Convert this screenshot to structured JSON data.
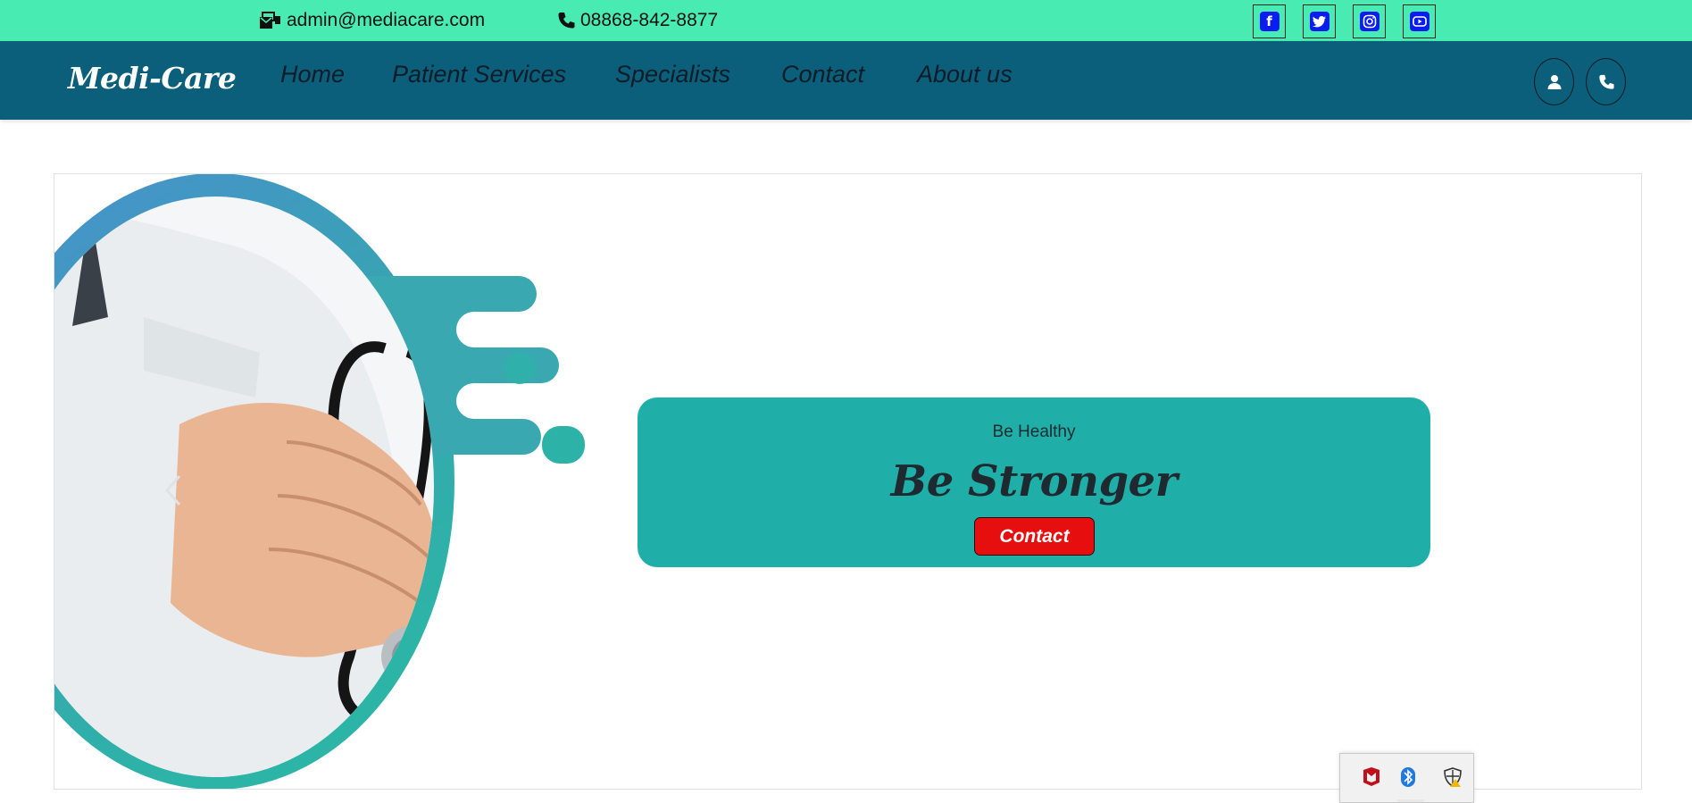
{
  "topbar": {
    "email": "admin@mediacare.com",
    "phone": "08868-842-8877",
    "social": [
      "facebook-icon",
      "twitter-icon",
      "instagram-icon",
      "youtube-icon"
    ],
    "bg_color": "#48ebb2",
    "icon_color": "#0a1cf0"
  },
  "navbar": {
    "brand": "Medi-Care",
    "links": [
      "Home",
      "Patient Services",
      "Specialists",
      "Contact",
      "About us"
    ],
    "icons": [
      "user-icon",
      "phone-icon"
    ],
    "bg_color": "#0b5f7a"
  },
  "hero": {
    "eyebrow": "Be Healthy",
    "headline": "Be Stronger",
    "cta_label": "Contact",
    "card_color": "#20afa8",
    "cta_color": "#e60e0e",
    "image": "doctor-with-stethoscope"
  },
  "tray": {
    "icons": [
      "mcafee-icon",
      "bluetooth-icon",
      "security-shield-icon"
    ]
  }
}
